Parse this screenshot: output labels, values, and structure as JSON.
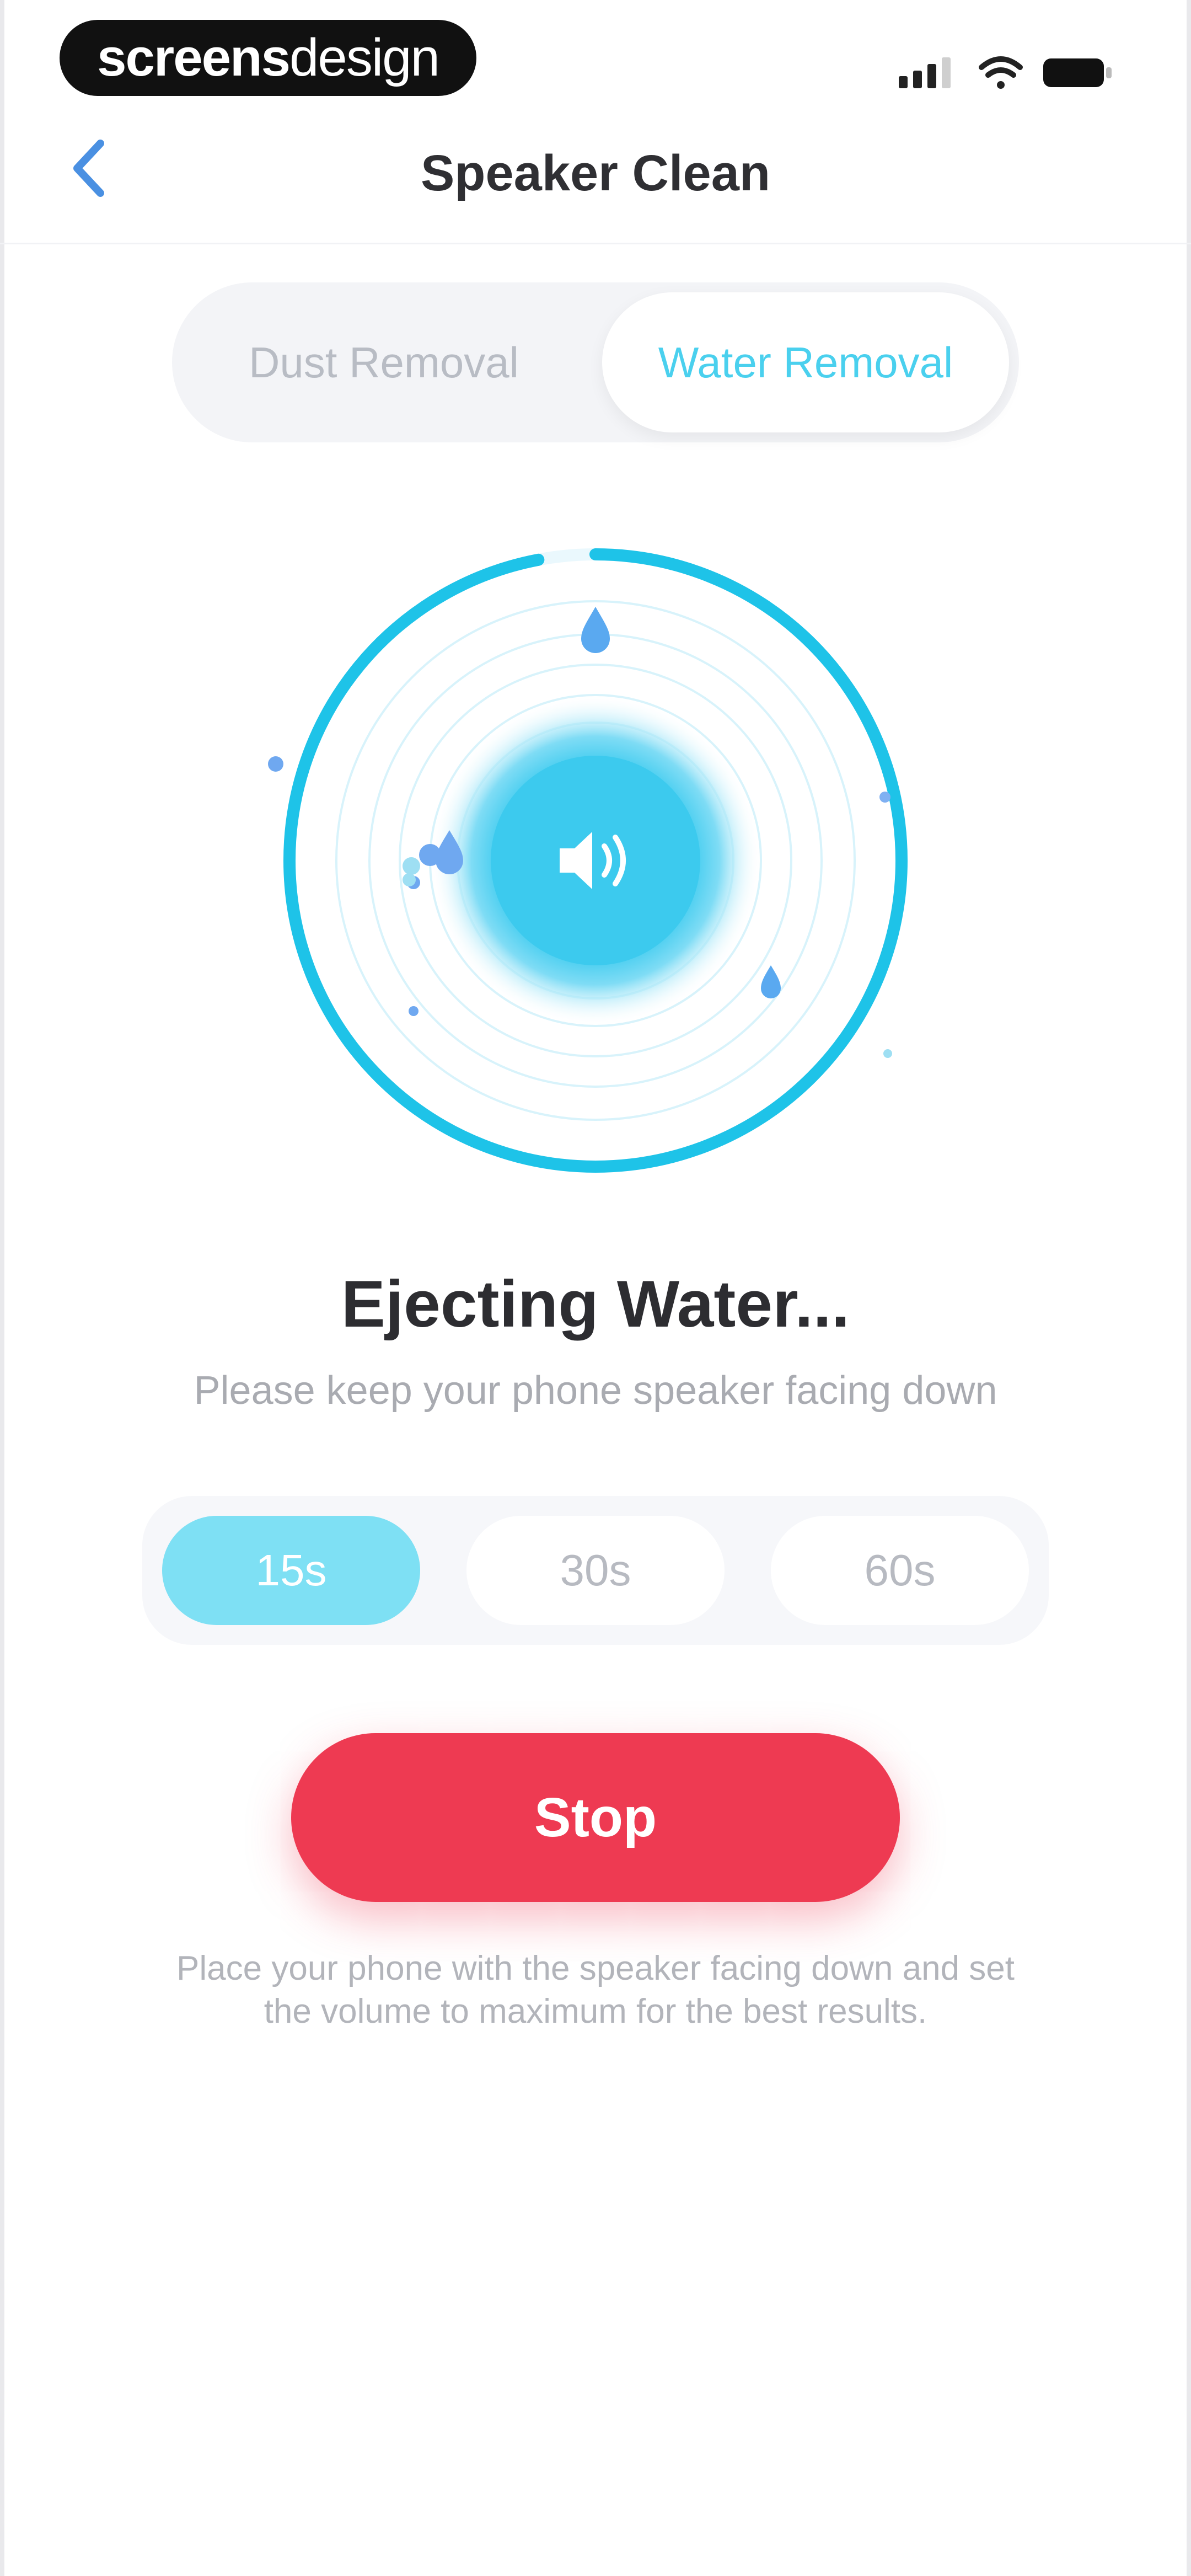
{
  "status_bar": {
    "brand_bold": "screens",
    "brand_light": "design",
    "icons": [
      "signal-icon",
      "wifi-icon",
      "battery-icon"
    ]
  },
  "header": {
    "title": "Speaker Clean",
    "back_icon": "chevron-left-icon"
  },
  "modes": {
    "items": [
      {
        "label": "Dust Removal",
        "selected": false
      },
      {
        "label": "Water Removal",
        "selected": true
      }
    ]
  },
  "animation": {
    "center_icon": "speaker-icon",
    "ring_color": "#1ec3e8",
    "progress": 0.97
  },
  "status": {
    "heading": "Ejecting Water...",
    "subtext": "Please keep your phone speaker facing down"
  },
  "durations": {
    "items": [
      {
        "label": "15s",
        "selected": true
      },
      {
        "label": "30s",
        "selected": false
      },
      {
        "label": "60s",
        "selected": false
      }
    ]
  },
  "actions": {
    "stop_label": "Stop"
  },
  "tip": {
    "line1": "Place your phone with the speaker facing down and set",
    "line2": "the volume to maximum for the best results."
  },
  "colors": {
    "accent": "#4ad0ee",
    "stop": "#ee3a52",
    "back": "#4a90e2"
  }
}
